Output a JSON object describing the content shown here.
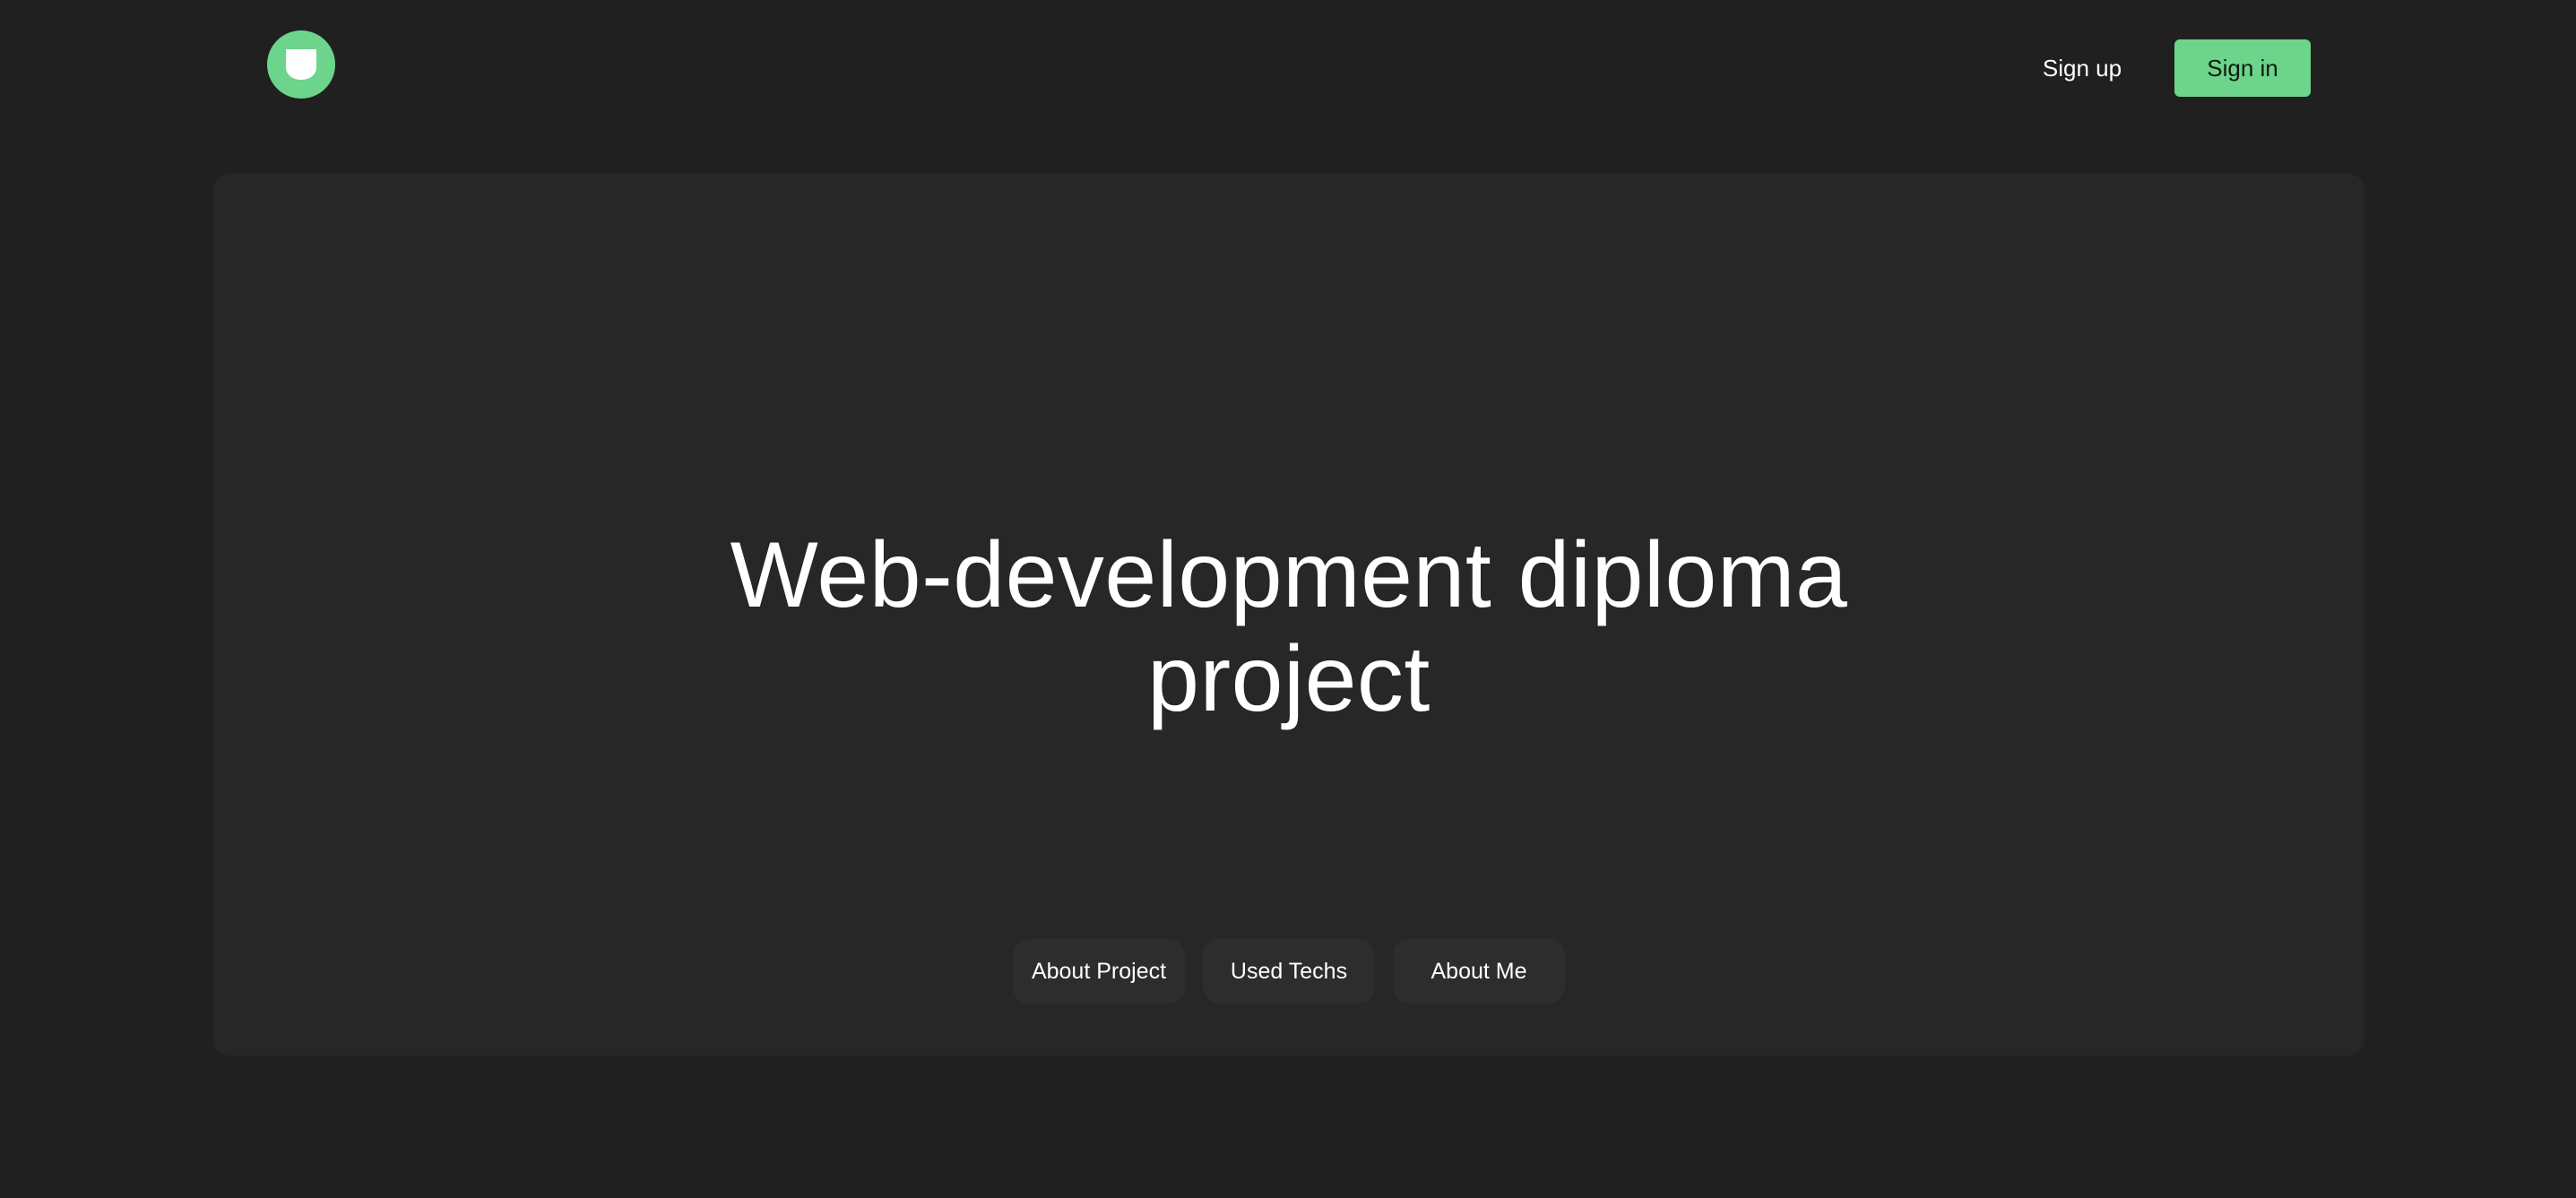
{
  "header": {
    "logo_icon": "shield-icon",
    "signup_label": "Sign up",
    "signin_label": "Sign in"
  },
  "hero": {
    "title_line1": "Web-development diploma",
    "title_line2": "project",
    "pills": [
      {
        "label": "About Project"
      },
      {
        "label": "Used Techs"
      },
      {
        "label": "About Me"
      }
    ]
  },
  "colors": {
    "background": "#202020",
    "card": "#272727",
    "accent": "#6cd58b",
    "pill": "#2d2d2d"
  }
}
